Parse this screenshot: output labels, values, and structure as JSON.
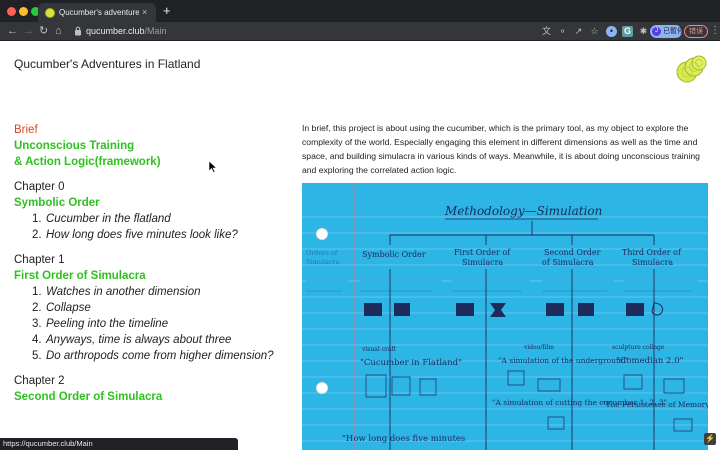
{
  "browser": {
    "tab_title": "Qucumber's adventure in flatl",
    "tab_close": "×",
    "new_tab": "+",
    "url_host": "qucumber.club",
    "url_path": "/Main",
    "pause_label": "已暫停",
    "pause_avatar": "J",
    "error_label": "错误",
    "status_url": "https://qucumber.club/Main",
    "icons": [
      "back-arrow-icon",
      "forward-arrow-icon",
      "reload-icon",
      "home-icon",
      "lock-icon",
      "translate-icon",
      "eye-slash-icon",
      "share-icon",
      "star-icon",
      "extension-icon",
      "puzzle-icon",
      "menu-icon"
    ]
  },
  "page": {
    "site_title": "Qucumber's Adventures in Flatland",
    "brief": "Brief",
    "brief_sub_1": "Unconscious Training",
    "brief_sub_2": "& Action Logic(framework)",
    "chapters": [
      {
        "label": "Chapter 0",
        "title": "Symbolic Order",
        "items": [
          "Cucumber in the flatland",
          "How long does five minutes look like?"
        ]
      },
      {
        "label": "Chapter 1",
        "title": "First Order of Simulacra",
        "items": [
          "Watches in another dimension",
          "Collapse",
          "Peeling into the timeline",
          "Anyways, time is always about three",
          "Do arthropods come from higher dimension?"
        ]
      },
      {
        "label": "Chapter 2",
        "title": "Second Order of Simulacra"
      }
    ],
    "intro": "In brief, this project is about using the cucumber, which is the primary tool, as my object to explore the complexity of the world. Especially engaging this element in different dimensions as well as the time and space, and building simulacra in various kinds of ways. Meanwhile, it is about doing unconscious training and exploring the correlated action logic."
  },
  "scan": {
    "heading": "Methodology—Simulation",
    "columns": [
      {
        "line1": "Symbolic Order",
        "line2": ""
      },
      {
        "line1": "First Order of",
        "line2": "Simulacra"
      },
      {
        "line1": "Second Order",
        "line2": "of Simulacra"
      },
      {
        "line1": "Third Order of",
        "line2": "Simulacra"
      }
    ],
    "side_note_1": "Orders of",
    "side_note_2": "Simulacra",
    "small_label_1": "visual craft",
    "small_label_2": "video/film",
    "small_label_3": "sculpture collage",
    "works": [
      "\"Cucumber in Flatland\"",
      "\"A simulation of the underground\"",
      "\"Comedian 2.0\"",
      "\"A simulation of cutting the cucumber 1, 2, 3\"",
      "\"The Persistence of Memory 2.0\"",
      "\"How long does five minutes"
    ]
  },
  "colors": {
    "chrome_dark": "#202124",
    "chrome_toolbar": "#35363a",
    "brief_orange": "#d24a26",
    "heading_green": "#2fc11f",
    "notebook_blue": "#2db5e6",
    "ink": "#1d2a5c"
  }
}
